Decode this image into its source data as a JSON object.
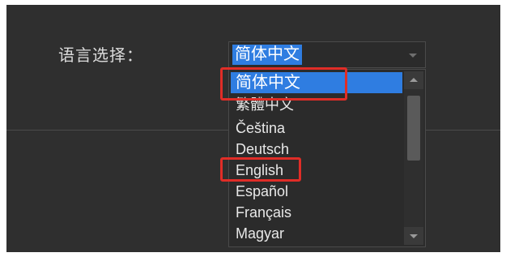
{
  "settings": {
    "language_label": "语言选择：",
    "selected_language": "简体中文"
  },
  "language_options": [
    "简体中文",
    "繁體中文",
    "Čeština",
    "Deutsch",
    "English",
    "Español",
    "Français",
    "Magyar"
  ],
  "colors": {
    "panel_background": "#2f2f2f",
    "selection": "#2f7de1",
    "highlight_box": "#e02d27"
  },
  "icons": {
    "combo_arrow": "chevron-down-icon",
    "scroll_up": "chevron-up-icon",
    "scroll_down": "chevron-down-icon"
  }
}
